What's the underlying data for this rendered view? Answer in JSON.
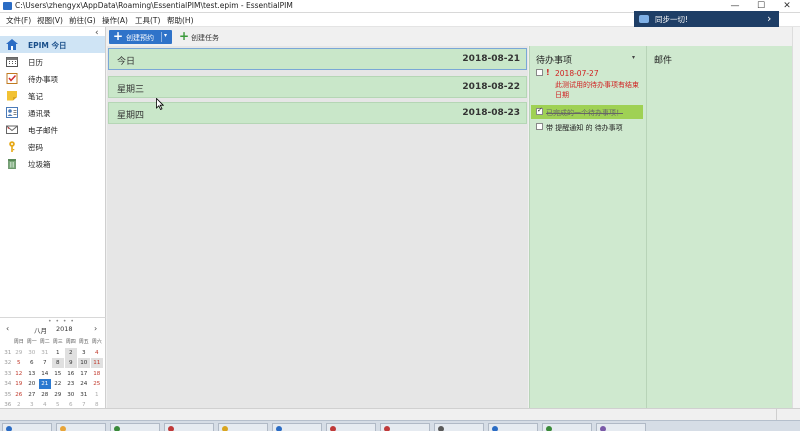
{
  "window": {
    "title": "C:\\Users\\zhengyx\\AppData\\Roaming\\EssentialPIM\\test.epim - EssentialPIM",
    "minimize": "—",
    "maximize": "☐",
    "close": "✕"
  },
  "menu": [
    "文件(F)",
    "视图(V)",
    "前往(G)",
    "操作(A)",
    "工具(T)",
    "帮助(H)"
  ],
  "sync": {
    "label": "同步一切!",
    "arrow": "›"
  },
  "sidebar": {
    "collapse": "‹",
    "items": [
      {
        "label": "EPIM 今日",
        "icon": "home-icon",
        "active": true
      },
      {
        "label": "日历",
        "icon": "calendar-icon"
      },
      {
        "label": "待办事项",
        "icon": "checklist-icon"
      },
      {
        "label": "笔记",
        "icon": "note-icon"
      },
      {
        "label": "通讯录",
        "icon": "contacts-icon"
      },
      {
        "label": "电子邮件",
        "icon": "mail-icon"
      },
      {
        "label": "密码",
        "icon": "key-icon"
      },
      {
        "label": "垃圾箱",
        "icon": "trash-icon"
      }
    ]
  },
  "calendar": {
    "grip": "• • • •",
    "prev": "‹",
    "next": "›",
    "month": "八月",
    "year": "2018",
    "weekdays": [
      "周日",
      "周一",
      "周二",
      "周三",
      "周四",
      "周五",
      "周六"
    ],
    "weeks": [
      {
        "wk": "31",
        "days": [
          "29",
          "30",
          "31",
          "1",
          "2",
          "3",
          "4"
        ]
      },
      {
        "wk": "32",
        "days": [
          "5",
          "6",
          "7",
          "8",
          "9",
          "10",
          "11"
        ]
      },
      {
        "wk": "33",
        "days": [
          "12",
          "13",
          "14",
          "15",
          "16",
          "17",
          "18"
        ]
      },
      {
        "wk": "34",
        "days": [
          "19",
          "20",
          "21",
          "22",
          "23",
          "24",
          "25"
        ]
      },
      {
        "wk": "35",
        "days": [
          "26",
          "27",
          "28",
          "29",
          "30",
          "31",
          "1"
        ]
      },
      {
        "wk": "36",
        "days": [
          "2",
          "3",
          "4",
          "5",
          "6",
          "7",
          "8"
        ]
      }
    ],
    "today": "21"
  },
  "toolbar": {
    "new_appointment": "创建预约",
    "new_task": "创建任务",
    "plus": "+",
    "dropdown": "▾"
  },
  "days": [
    {
      "name": "今日",
      "date": "2018-08-21"
    },
    {
      "name": "星期三",
      "date": "2018-08-22"
    },
    {
      "name": "星期四",
      "date": "2018-08-23"
    }
  ],
  "todo": {
    "title": "待办事项",
    "menu": "▾",
    "items": [
      {
        "flag": "!",
        "date": "2018-07-27",
        "text": "此测试用的待办事项有结束日期",
        "checked": false
      },
      {
        "text": "已完成的一个待办事项！",
        "checked": true
      },
      {
        "text": "带 提醒通知 的 待办事项",
        "checked": false
      }
    ]
  },
  "mail": {
    "title": "邮件"
  },
  "colors": {
    "accent": "#2f73c9",
    "panel_green": "#cfe9cf",
    "day_green": "#c9e7c9",
    "sync_bg": "#1e3e66",
    "overdue_red": "#d02020",
    "done_highlight": "#9fd154"
  }
}
